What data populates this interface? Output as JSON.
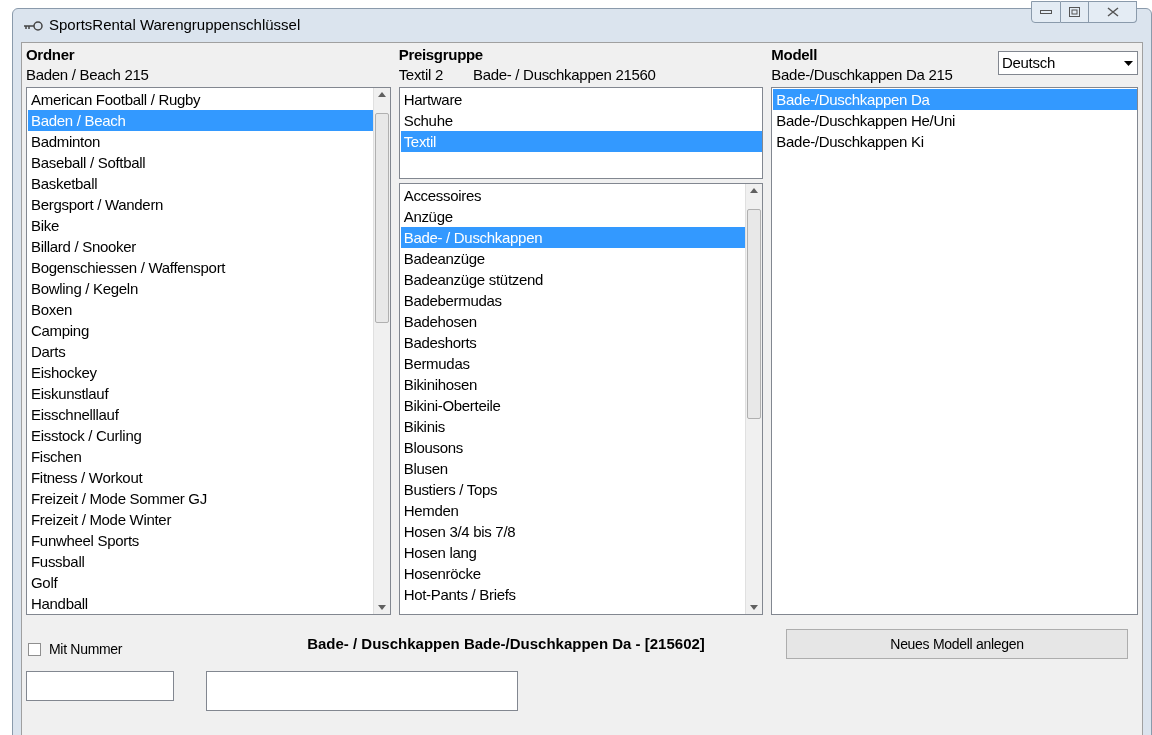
{
  "window": {
    "title": "SportsRental Warengruppenschlüssel"
  },
  "ordner": {
    "heading": "Ordner",
    "current": "Baden / Beach 215",
    "items": [
      {
        "label": "American Football / Rugby",
        "selected": false
      },
      {
        "label": "Baden / Beach",
        "selected": true
      },
      {
        "label": "Badminton",
        "selected": false
      },
      {
        "label": "Baseball / Softball",
        "selected": false
      },
      {
        "label": "Basketball",
        "selected": false
      },
      {
        "label": "Bergsport / Wandern",
        "selected": false
      },
      {
        "label": "Bike",
        "selected": false
      },
      {
        "label": "Billard / Snooker",
        "selected": false
      },
      {
        "label": "Bogenschiessen / Waffensport",
        "selected": false
      },
      {
        "label": "Bowling / Kegeln",
        "selected": false
      },
      {
        "label": "Boxen",
        "selected": false
      },
      {
        "label": "Camping",
        "selected": false
      },
      {
        "label": "Darts",
        "selected": false
      },
      {
        "label": "Eishockey",
        "selected": false
      },
      {
        "label": "Eiskunstlauf",
        "selected": false
      },
      {
        "label": "Eisschnelllauf",
        "selected": false
      },
      {
        "label": "Eisstock / Curling",
        "selected": false
      },
      {
        "label": "Fischen",
        "selected": false
      },
      {
        "label": "Fitness / Workout",
        "selected": false
      },
      {
        "label": "Freizeit / Mode Sommer GJ",
        "selected": false
      },
      {
        "label": "Freizeit / Mode Winter",
        "selected": false
      },
      {
        "label": "Funwheel Sports",
        "selected": false
      },
      {
        "label": "Fussball",
        "selected": false
      },
      {
        "label": "Golf",
        "selected": false
      },
      {
        "label": "Handball",
        "selected": false
      }
    ]
  },
  "preisgruppe": {
    "heading": "Preisgruppe",
    "current": "Textil 2",
    "current_detail": "Bade- / Duschkappen 21560",
    "groups": [
      {
        "label": "Hartware",
        "selected": false
      },
      {
        "label": "Schuhe",
        "selected": false
      },
      {
        "label": "Textil",
        "selected": true
      }
    ],
    "items": [
      {
        "label": "Accessoires",
        "selected": false
      },
      {
        "label": "Anzüge",
        "selected": false
      },
      {
        "label": "Bade- / Duschkappen",
        "selected": true
      },
      {
        "label": "Badeanzüge",
        "selected": false
      },
      {
        "label": "Badeanzüge stützend",
        "selected": false
      },
      {
        "label": "Badebermudas",
        "selected": false
      },
      {
        "label": "Badehosen",
        "selected": false
      },
      {
        "label": "Badeshorts",
        "selected": false
      },
      {
        "label": "Bermudas",
        "selected": false
      },
      {
        "label": "Bikinihosen",
        "selected": false
      },
      {
        "label": "Bikini-Oberteile",
        "selected": false
      },
      {
        "label": "Bikinis",
        "selected": false
      },
      {
        "label": "Blousons",
        "selected": false
      },
      {
        "label": "Blusen",
        "selected": false
      },
      {
        "label": "Bustiers / Tops",
        "selected": false
      },
      {
        "label": "Hemden",
        "selected": false
      },
      {
        "label": "Hosen 3/4 bis 7/8",
        "selected": false
      },
      {
        "label": "Hosen lang",
        "selected": false
      },
      {
        "label": "Hosenröcke",
        "selected": false
      },
      {
        "label": "Hot-Pants / Briefs",
        "selected": false
      }
    ]
  },
  "modell": {
    "heading": "Modell",
    "current": "Bade-/Duschkappen Da 215",
    "language": "Deutsch",
    "items": [
      {
        "label": "Bade-/Duschkappen Da",
        "selected": true
      },
      {
        "label": "Bade-/Duschkappen He/Uni",
        "selected": false
      },
      {
        "label": "Bade-/Duschkappen Ki",
        "selected": false
      }
    ]
  },
  "footer": {
    "mit_nummer": {
      "label": "Mit Nummer",
      "checked": false
    },
    "summary": "Bade- / Duschkappen Bade-/Duschkappen Da - [215602]",
    "new_button": "Neues Modell anlegen"
  }
}
